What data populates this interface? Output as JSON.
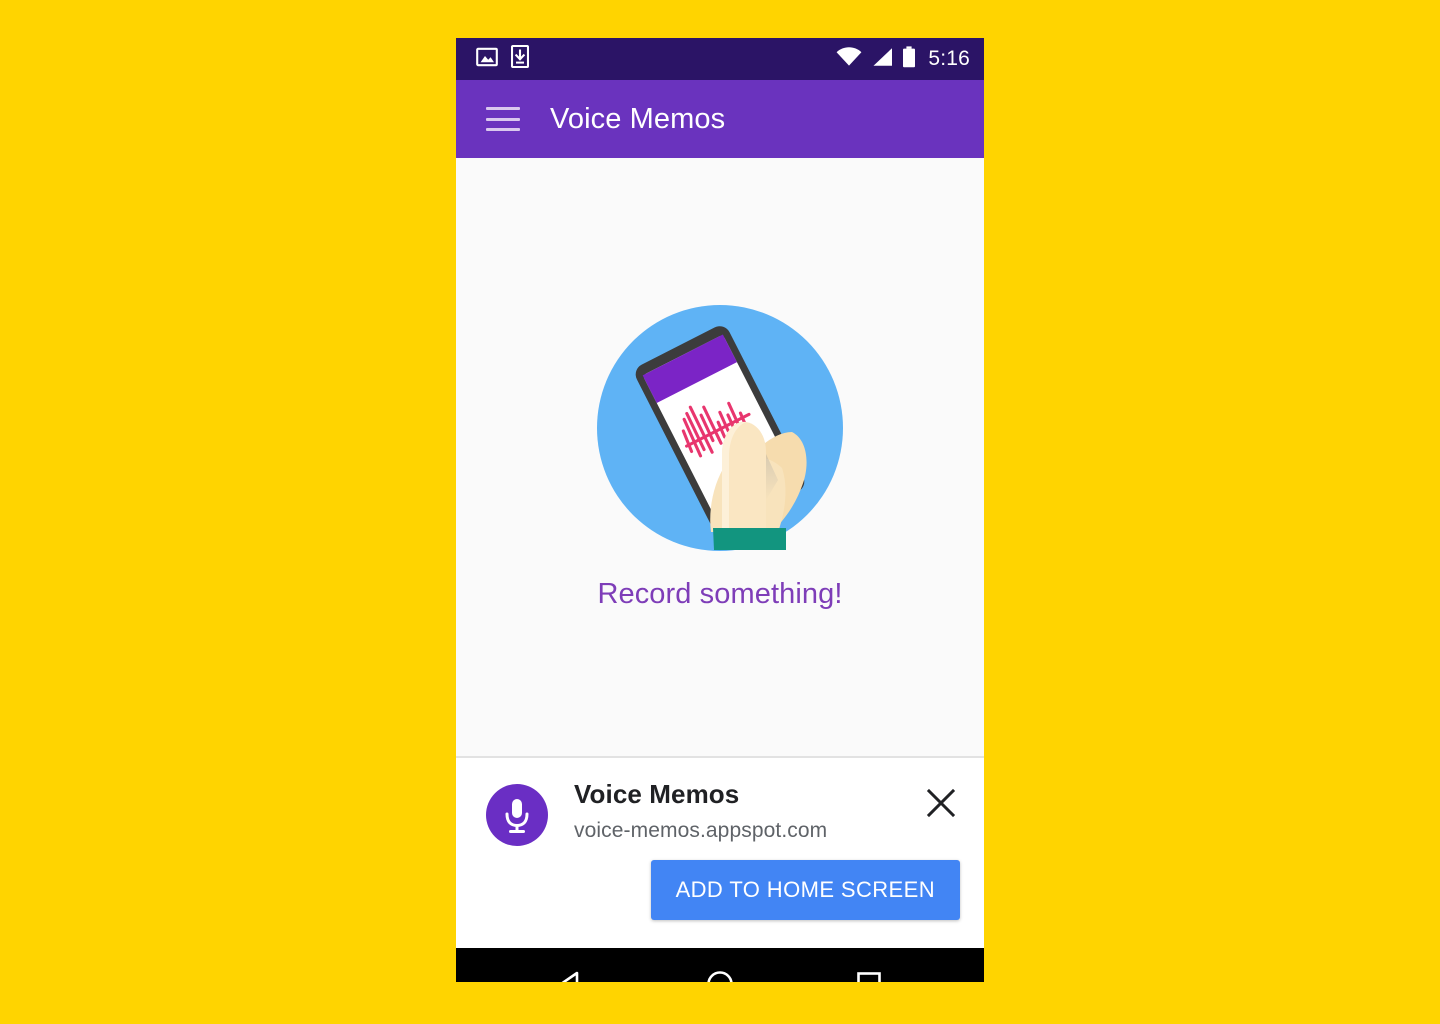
{
  "theme": {
    "page_background": "#FFD400",
    "status_bar": "#2B1466",
    "app_bar": "#6A33BE",
    "content_background": "#FAFAFA",
    "accent_purple": "#7E3DB8",
    "button_blue": "#4285F4",
    "illustration_circle": "#5FB3F5",
    "waveform_pink": "#E8366E",
    "app_icon_purple": "#6A2EC4",
    "nav_bar": "#000000"
  },
  "status_bar": {
    "left_icons": [
      "image-icon",
      "download-icon"
    ],
    "right_icons": [
      "wifi-icon",
      "cellular-signal-icon",
      "battery-icon"
    ],
    "time": "5:16"
  },
  "app_bar": {
    "menu_icon": "hamburger-menu-icon",
    "title": "Voice Memos"
  },
  "content": {
    "illustration": "hand-holding-phone-recording-illustration",
    "empty_state_text": "Record something!"
  },
  "install_banner": {
    "app_icon": "microphone-icon",
    "title": "Voice Memos",
    "url": "voice-memos.appspot.com",
    "close_icon": "close-icon",
    "install_button_label": "ADD TO HOME SCREEN"
  },
  "nav_bar": {
    "back": "back-triangle-icon",
    "home": "home-circle-icon",
    "recents": "recents-square-icon"
  }
}
